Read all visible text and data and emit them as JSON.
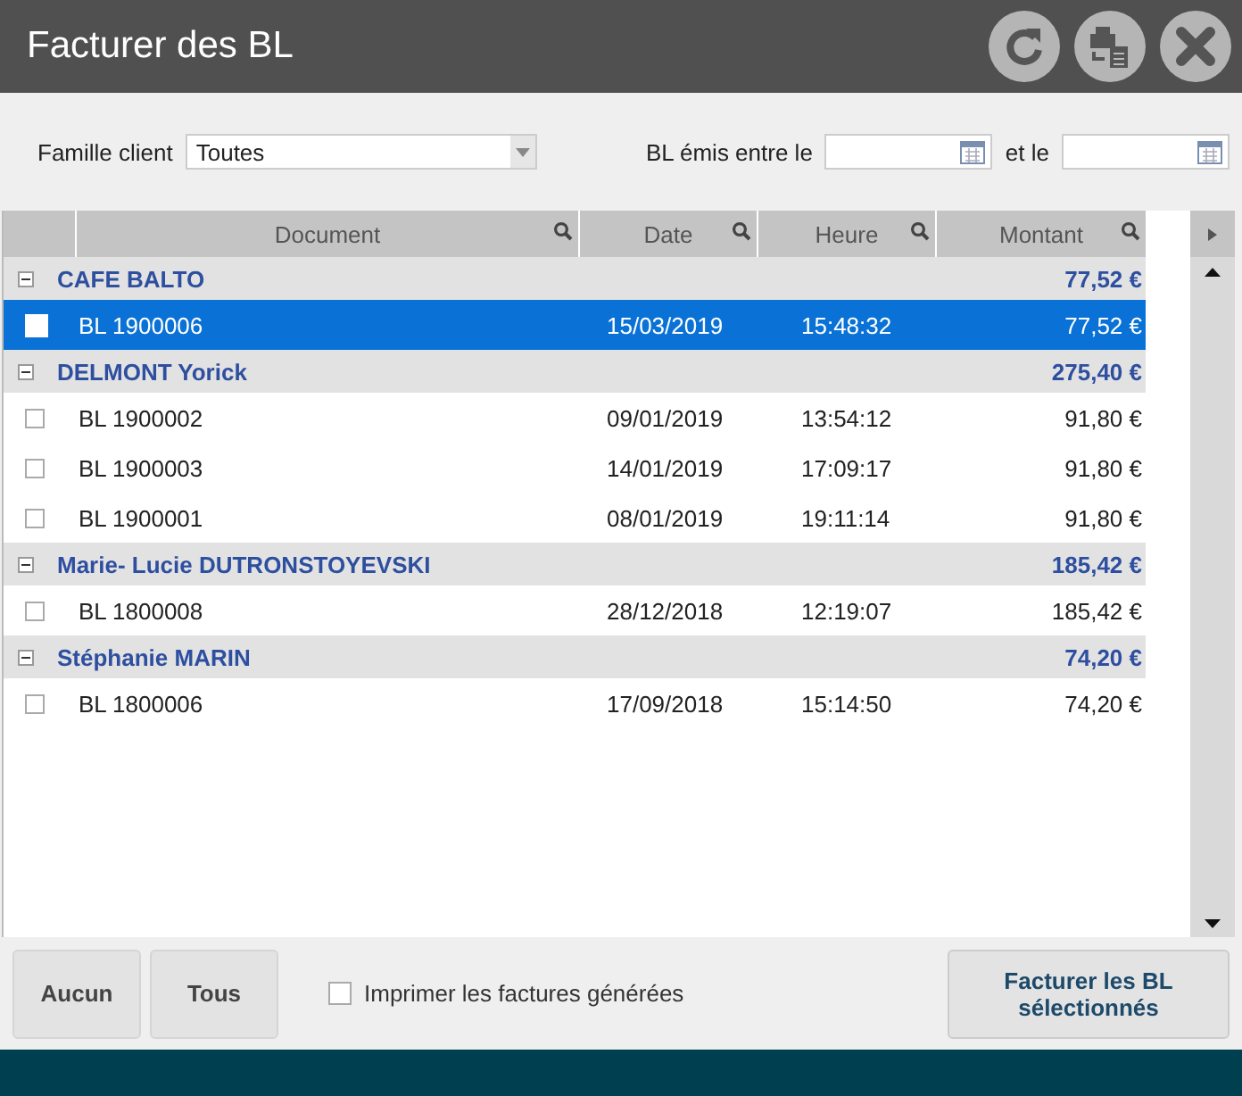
{
  "window": {
    "title": "Facturer des BL"
  },
  "filters": {
    "family_label": "Famille client",
    "family_value": "Toutes",
    "date_label": "BL émis entre le",
    "and_label": "et le"
  },
  "table": {
    "columns": [
      "Document",
      "Date",
      "Heure",
      "Montant"
    ],
    "groups": [
      {
        "name": "CAFE BALTO",
        "total": "77,52 €",
        "expanded": true,
        "rows": [
          {
            "document": "BL 1900006",
            "date": "15/03/2019",
            "time": "15:48:32",
            "amount": "77,52 €",
            "checked": false,
            "selected": true
          }
        ]
      },
      {
        "name": "DELMONT Yorick",
        "total": "275,40 €",
        "expanded": true,
        "rows": [
          {
            "document": "BL 1900002",
            "date": "09/01/2019",
            "time": "13:54:12",
            "amount": "91,80 €",
            "checked": false,
            "selected": false
          },
          {
            "document": "BL 1900003",
            "date": "14/01/2019",
            "time": "17:09:17",
            "amount": "91,80 €",
            "checked": false,
            "selected": false
          },
          {
            "document": "BL 1900001",
            "date": "08/01/2019",
            "time": "19:11:14",
            "amount": "91,80 €",
            "checked": false,
            "selected": false
          }
        ]
      },
      {
        "name": "Marie- Lucie DUTRONSTOYEVSKI",
        "total": "185,42 €",
        "expanded": true,
        "rows": [
          {
            "document": "BL 1800008",
            "date": "28/12/2018",
            "time": "12:19:07",
            "amount": "185,42 €",
            "checked": false,
            "selected": false
          }
        ]
      },
      {
        "name": "Stéphanie MARIN",
        "total": "74,20 €",
        "expanded": true,
        "rows": [
          {
            "document": "BL 1800006",
            "date": "17/09/2018",
            "time": "15:14:50",
            "amount": "74,20 €",
            "checked": false,
            "selected": false
          }
        ]
      }
    ]
  },
  "footer": {
    "none_button": "Aucun",
    "all_button": "Tous",
    "print_label": "Imprimer les factures générées",
    "print_checked": false,
    "invoice_button": "Facturer les BL sélectionnés"
  }
}
